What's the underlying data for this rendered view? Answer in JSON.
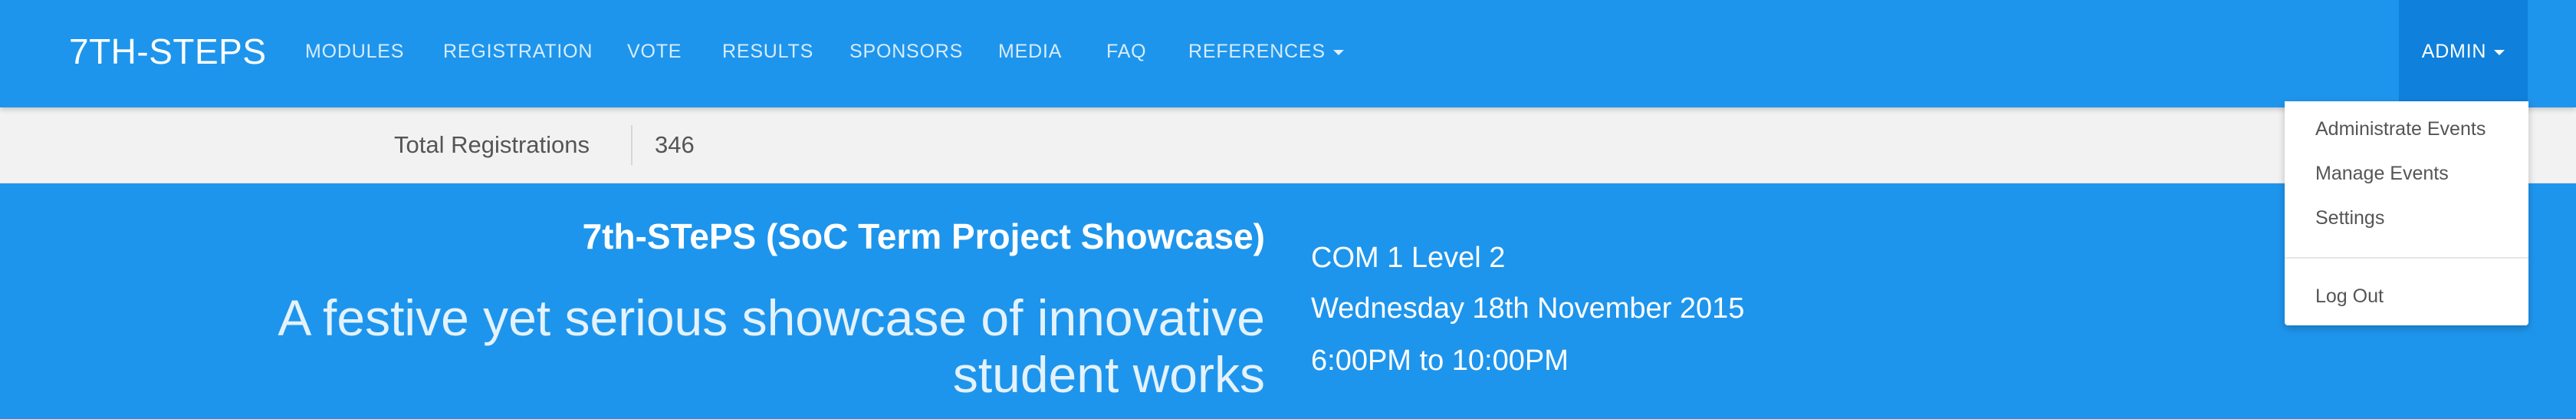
{
  "navbar": {
    "brand": "7TH-STEPS",
    "items": [
      {
        "label": "MODULES"
      },
      {
        "label": "REGISTRATION"
      },
      {
        "label": "VOTE"
      },
      {
        "label": "RESULTS"
      },
      {
        "label": "SPONSORS"
      },
      {
        "label": "MEDIA"
      },
      {
        "label": "FAQ"
      },
      {
        "label": "REFERENCES",
        "has_dropdown": true
      }
    ],
    "admin": {
      "label": "ADMIN",
      "expanded": true
    },
    "colors": {
      "bar": "#1e95ec",
      "admin_active": "#0f80db"
    }
  },
  "admin_menu": {
    "items": [
      {
        "label": "Administrate Events"
      },
      {
        "label": "Manage Events"
      },
      {
        "label": "Settings"
      }
    ],
    "logout": "Log Out"
  },
  "stats": {
    "label": "Total Registrations",
    "value": "346"
  },
  "hero": {
    "title": "7th-STePS (SoC Term Project Showcase)",
    "description": "A festive yet serious showcase of innovative student works",
    "venue": "COM 1 Level 2",
    "date": "Wednesday 18th November 2015",
    "time": "6:00PM to 10:00PM",
    "background": "#1e95ec"
  }
}
